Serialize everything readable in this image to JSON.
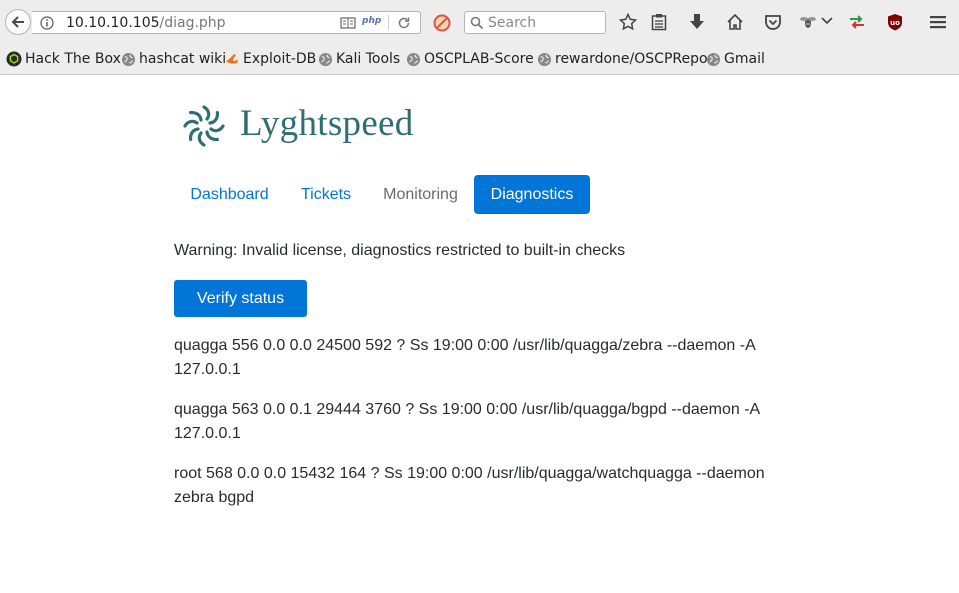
{
  "browser": {
    "url_host": "10.10.10.105",
    "url_path": "/diag.php",
    "php_badge": "php",
    "search_placeholder": "Search",
    "icons": [
      "back-arrow-icon",
      "info-icon",
      "reader-view-icon",
      "reload-icon",
      "noscript-icon",
      "search-icon",
      "star-icon",
      "clipboard-icon",
      "download-icon",
      "home-icon",
      "pocket-icon",
      "wasp-icon",
      "chevron-down-icon",
      "foxyproxy-icon",
      "ublock-icon",
      "hamburger-menu-icon"
    ]
  },
  "bookmarks": [
    {
      "label": "Hack The Box",
      "icon": "htb-icon"
    },
    {
      "label": "hashcat wiki",
      "icon": "globe-icon"
    },
    {
      "label": "Exploit-DB",
      "icon": "exploitdb-icon"
    },
    {
      "label": "Kali Tools",
      "icon": "globe-icon"
    },
    {
      "label": "OSCPLAB-Score",
      "icon": "globe-icon"
    },
    {
      "label": "rewardone/OSCPRepo",
      "icon": "globe-icon"
    },
    {
      "label": "Gmail",
      "icon": "globe-icon"
    }
  ],
  "page": {
    "brand": "Lyghtspeed",
    "nav": [
      {
        "label": "Dashboard",
        "state": "link"
      },
      {
        "label": "Tickets",
        "state": "link"
      },
      {
        "label": "Monitoring",
        "state": "disabled"
      },
      {
        "label": "Diagnostics",
        "state": "active"
      }
    ],
    "warning": "Warning: Invalid license, diagnostics restricted to built-in checks",
    "verify_button": "Verify status",
    "processes": [
      "quagga 556 0.0 0.0 24500 592 ? Ss 19:00 0:00 /usr/lib/quagga/zebra --daemon -A 127.0.0.1",
      "quagga 563 0.0 0.1 29444 3760 ? Ss 19:00 0:00 /usr/lib/quagga/bgpd --daemon -A 127.0.0.1",
      "root 568 0.0 0.0 15432 164 ? Ss 19:00 0:00 /usr/lib/quagga/watchquagga --daemon zebra bgpd"
    ]
  },
  "colors": {
    "primary": "#0275d8",
    "brand": "#2f6e73",
    "text": "#292b2c",
    "muted": "#636c72"
  }
}
